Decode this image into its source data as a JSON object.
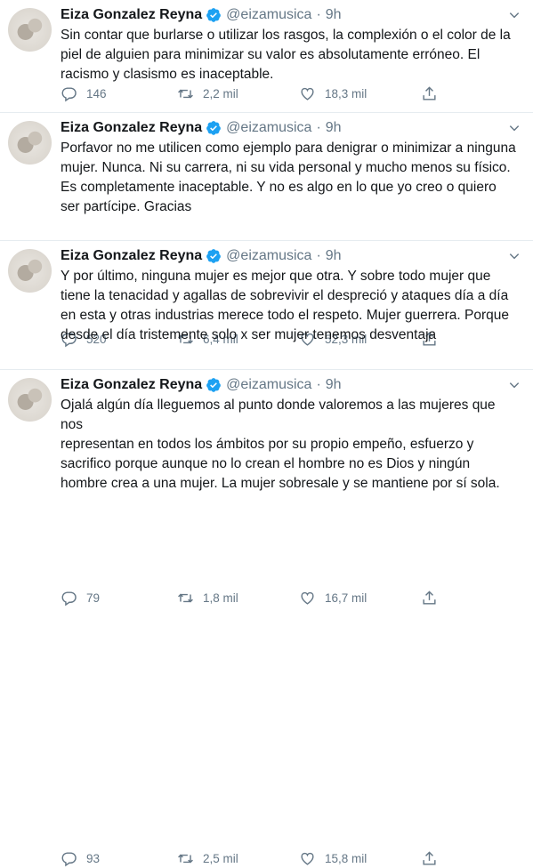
{
  "tweets": [
    {
      "name": "Eiza Gonzalez Reyna",
      "handle": "@eizamusica",
      "separator": "·",
      "time": "9h",
      "text": "Sin contar que burlarse o utilizar los rasgos, la complexión o el color de la\npiel de alguien para minimizar su valor es absolutamente erróneo. El\nracismo y clasismo es inaceptable.",
      "replies": "146",
      "retweets": "2,2 mil",
      "likes": "18,3 mil"
    },
    {
      "name": "Eiza Gonzalez Reyna",
      "handle": "@eizamusica",
      "separator": "·",
      "time": "9h",
      "text": "Porfavor no me utilicen como ejemplo para denigrar o minimizar a ninguna\nmujer. Nunca. Ni su carrera, ni su vida personal y mucho menos su físico.\nEs completamente inaceptable. Y no es algo en lo que yo creo o quiero\nser partícipe. Gracias",
      "replies": "520",
      "retweets": "6,4 mil",
      "likes": "52,3 mil"
    },
    {
      "name": "Eiza Gonzalez Reyna",
      "handle": "@eizamusica",
      "separator": "·",
      "time": "9h",
      "text": "Y por último, ninguna mujer es mejor que otra. Y sobre todo mujer que\ntiene la tenacidad y agallas de sobrevivir el despreció y ataques día a día\nen esta y otras industrias merece todo el respeto. Mujer guerrera. Porque\ndesde el día tristemente solo x ser mujer tenemos desventaja",
      "replies": "79",
      "retweets": "1,8 mil",
      "likes": "16,7 mil"
    },
    {
      "name": "Eiza Gonzalez Reyna",
      "handle": "@eizamusica",
      "separator": "·",
      "time": "9h",
      "text": "Ojalá algún día lleguemos al punto donde valoremos a las mujeres que nos\nrepresentan en todos los ámbitos por su propio empeño, esfuerzo y\nsacrifico porque aunque no lo crean el hombre no es Dios y ningún\nhombre crea a una mujer. La mujer sobresale y se mantiene por sí sola.",
      "replies": "93",
      "retweets": "2,5 mil",
      "likes": "15,8 mil"
    }
  ],
  "icons": {
    "verified": "verified-badge-icon",
    "caret": "chevron-down-icon",
    "reply": "reply-icon",
    "retweet": "retweet-icon",
    "like": "heart-icon",
    "share": "share-icon"
  },
  "colors": {
    "accent": "#1da1f2",
    "muted": "#657786",
    "text": "#14171a",
    "divider": "#e6ecf0"
  }
}
